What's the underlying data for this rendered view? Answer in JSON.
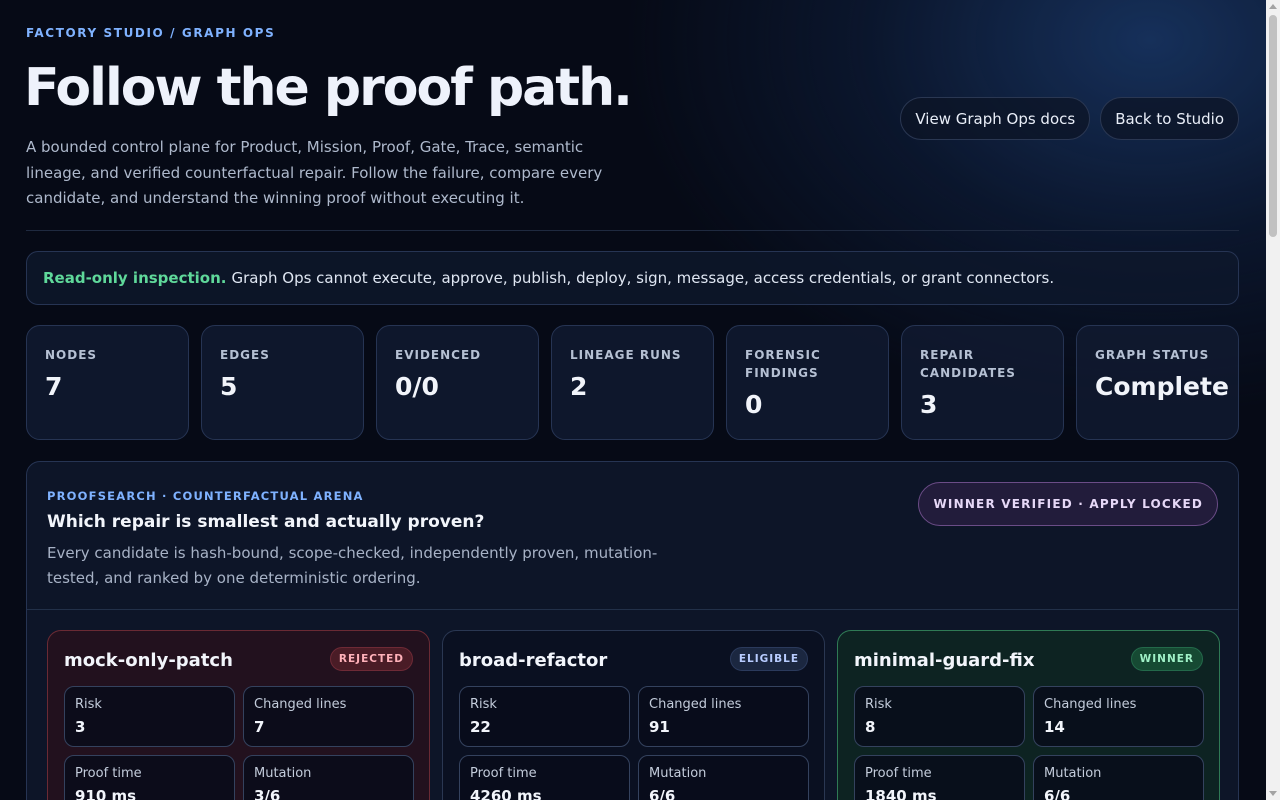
{
  "header": {
    "eyebrow": "FACTORY STUDIO / GRAPH OPS",
    "title": "Follow the proof path.",
    "description": "A bounded control plane for Product, Mission, Proof, Gate, Trace, semantic lineage, and verified counterfactual repair. Follow the failure, compare every candidate, and understand the winning proof without executing it.",
    "actions": {
      "docs_label": "View Graph Ops docs",
      "back_label": "Back to Studio"
    }
  },
  "notice": {
    "strong": "Read-only inspection.",
    "text": "Graph Ops cannot execute, approve, publish, deploy, sign, message, access credentials, or grant connectors."
  },
  "stats": [
    {
      "label": "NODES",
      "value": "7"
    },
    {
      "label": "EDGES",
      "value": "5"
    },
    {
      "label": "EVIDENCED",
      "value": "0/0"
    },
    {
      "label": "LINEAGE RUNS",
      "value": "2"
    },
    {
      "label": "FORENSIC FINDINGS",
      "value": "0"
    },
    {
      "label": "REPAIR CANDIDATES",
      "value": "3"
    },
    {
      "label": "GRAPH STATUS",
      "value": "Complete"
    }
  ],
  "arena": {
    "eyebrow": "PROOFSEARCH · COUNTERFACTUAL ARENA",
    "title": "Which repair is smallest and actually proven?",
    "description": "Every candidate is hash-bound, scope-checked, independently proven, mutation-tested, and ranked by one deterministic ordering.",
    "badge": "WINNER VERIFIED · APPLY LOCKED",
    "candidates": [
      {
        "name": "mock-only-patch",
        "tag": "REJECTED",
        "metrics": [
          {
            "label": "Risk",
            "value": "3"
          },
          {
            "label": "Changed lines",
            "value": "7"
          },
          {
            "label": "Proof time",
            "value": "910 ms"
          },
          {
            "label": "Mutation",
            "value": "3/6"
          }
        ]
      },
      {
        "name": "broad-refactor",
        "tag": "ELIGIBLE",
        "metrics": [
          {
            "label": "Risk",
            "value": "22"
          },
          {
            "label": "Changed lines",
            "value": "91"
          },
          {
            "label": "Proof time",
            "value": "4260 ms"
          },
          {
            "label": "Mutation",
            "value": "6/6"
          }
        ]
      },
      {
        "name": "minimal-guard-fix",
        "tag": "WINNER",
        "metrics": [
          {
            "label": "Risk",
            "value": "8"
          },
          {
            "label": "Changed lines",
            "value": "14"
          },
          {
            "label": "Proof time",
            "value": "1840 ms"
          },
          {
            "label": "Mutation",
            "value": "6/6"
          }
        ]
      }
    ]
  }
}
